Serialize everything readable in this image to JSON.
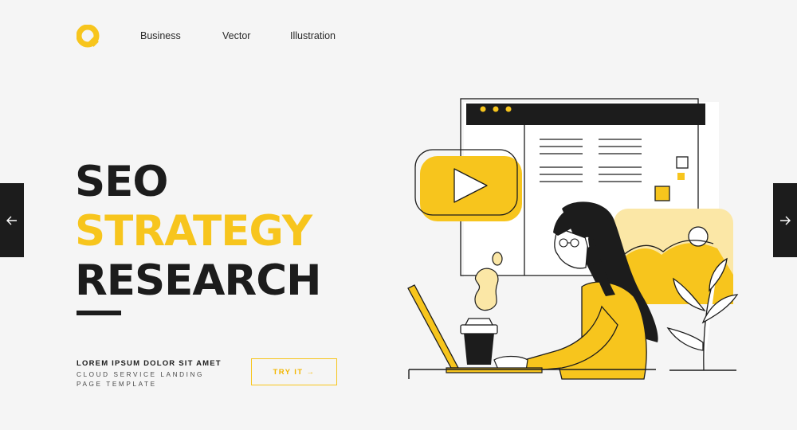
{
  "brand": {
    "logo_icon": "q-logo-icon",
    "accent": "#f7c51d",
    "dark": "#1c1c1c"
  },
  "nav": {
    "items": [
      "Business",
      "Vector",
      "Illustration"
    ]
  },
  "hero": {
    "line1": "SEO",
    "line2": "STRATEGY",
    "line3": "RESEARCH",
    "tagline": "LOREM IPSUM DOLOR SIT AMET",
    "sub_line1": "CLOUD SERVICE LANDING",
    "sub_line2": "PAGE TEMPLATE",
    "cta_label": "TRY IT →"
  },
  "carousel": {
    "prev_icon": "arrow-left-icon",
    "next_icon": "arrow-right-icon"
  },
  "illustration": {
    "icons": [
      "browser-window-icon",
      "video-play-icon",
      "woman-laptop-icon",
      "coffee-cup-icon",
      "image-placeholder-icon",
      "plant-icon"
    ]
  }
}
